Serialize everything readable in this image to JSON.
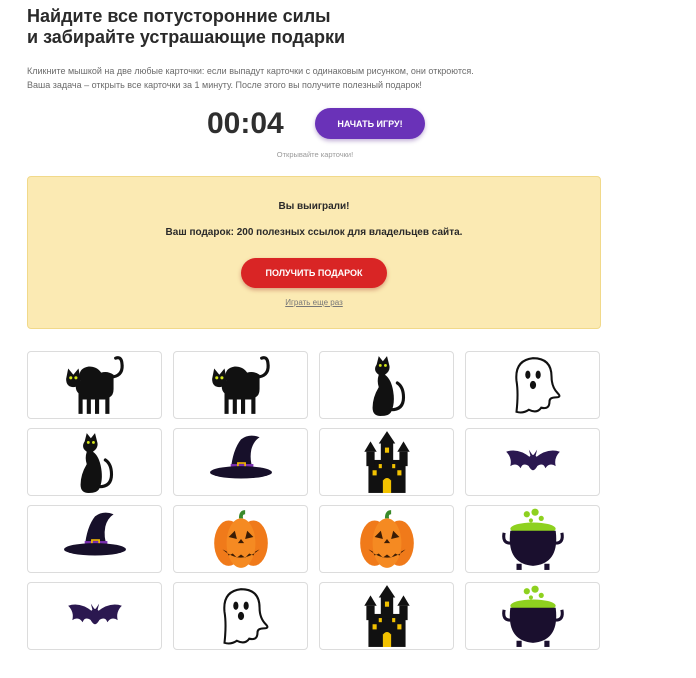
{
  "header": {
    "title_line1": "Найдите все потусторонние силы",
    "title_line2": "и забирайте устрашающие подарки"
  },
  "description": {
    "line1": "Кликните мышкой на две любые карточки: если выпадут карточки с одинаковым рисунком, они откроются.",
    "line2": "Ваша задача – открыть все карточки за 1 минуту. После этого вы получите полезный подарок!"
  },
  "game": {
    "timer": "00:04",
    "start_label": "НАЧАТЬ ИГРУ!",
    "hint": "Открывайте карточки!"
  },
  "result": {
    "won_text": "Вы выиграли!",
    "gift_text": "Ваш подарок: 200 полезных ссылок для владельцев сайта.",
    "gift_button": "ПОЛУЧИТЬ ПОДАРОК",
    "replay_link": "Играть еще раз"
  },
  "cards": [
    {
      "icon": "black-cat-arched-icon"
    },
    {
      "icon": "black-cat-arched-icon"
    },
    {
      "icon": "black-cat-sitting-icon"
    },
    {
      "icon": "ghost-icon"
    },
    {
      "icon": "black-cat-sitting-icon"
    },
    {
      "icon": "witch-hat-icon"
    },
    {
      "icon": "haunted-castle-icon"
    },
    {
      "icon": "bat-icon"
    },
    {
      "icon": "witch-hat-icon"
    },
    {
      "icon": "pumpkin-icon"
    },
    {
      "icon": "pumpkin-icon"
    },
    {
      "icon": "cauldron-icon"
    },
    {
      "icon": "bat-icon"
    },
    {
      "icon": "ghost-icon"
    },
    {
      "icon": "haunted-castle-icon"
    },
    {
      "icon": "cauldron-icon"
    }
  ],
  "colors": {
    "start_button": "#6a32b8",
    "gift_button": "#d92525",
    "result_background": "#fbeab3",
    "pumpkin": "#f07a1a",
    "witch_hat_band": "#7a2fb0"
  }
}
